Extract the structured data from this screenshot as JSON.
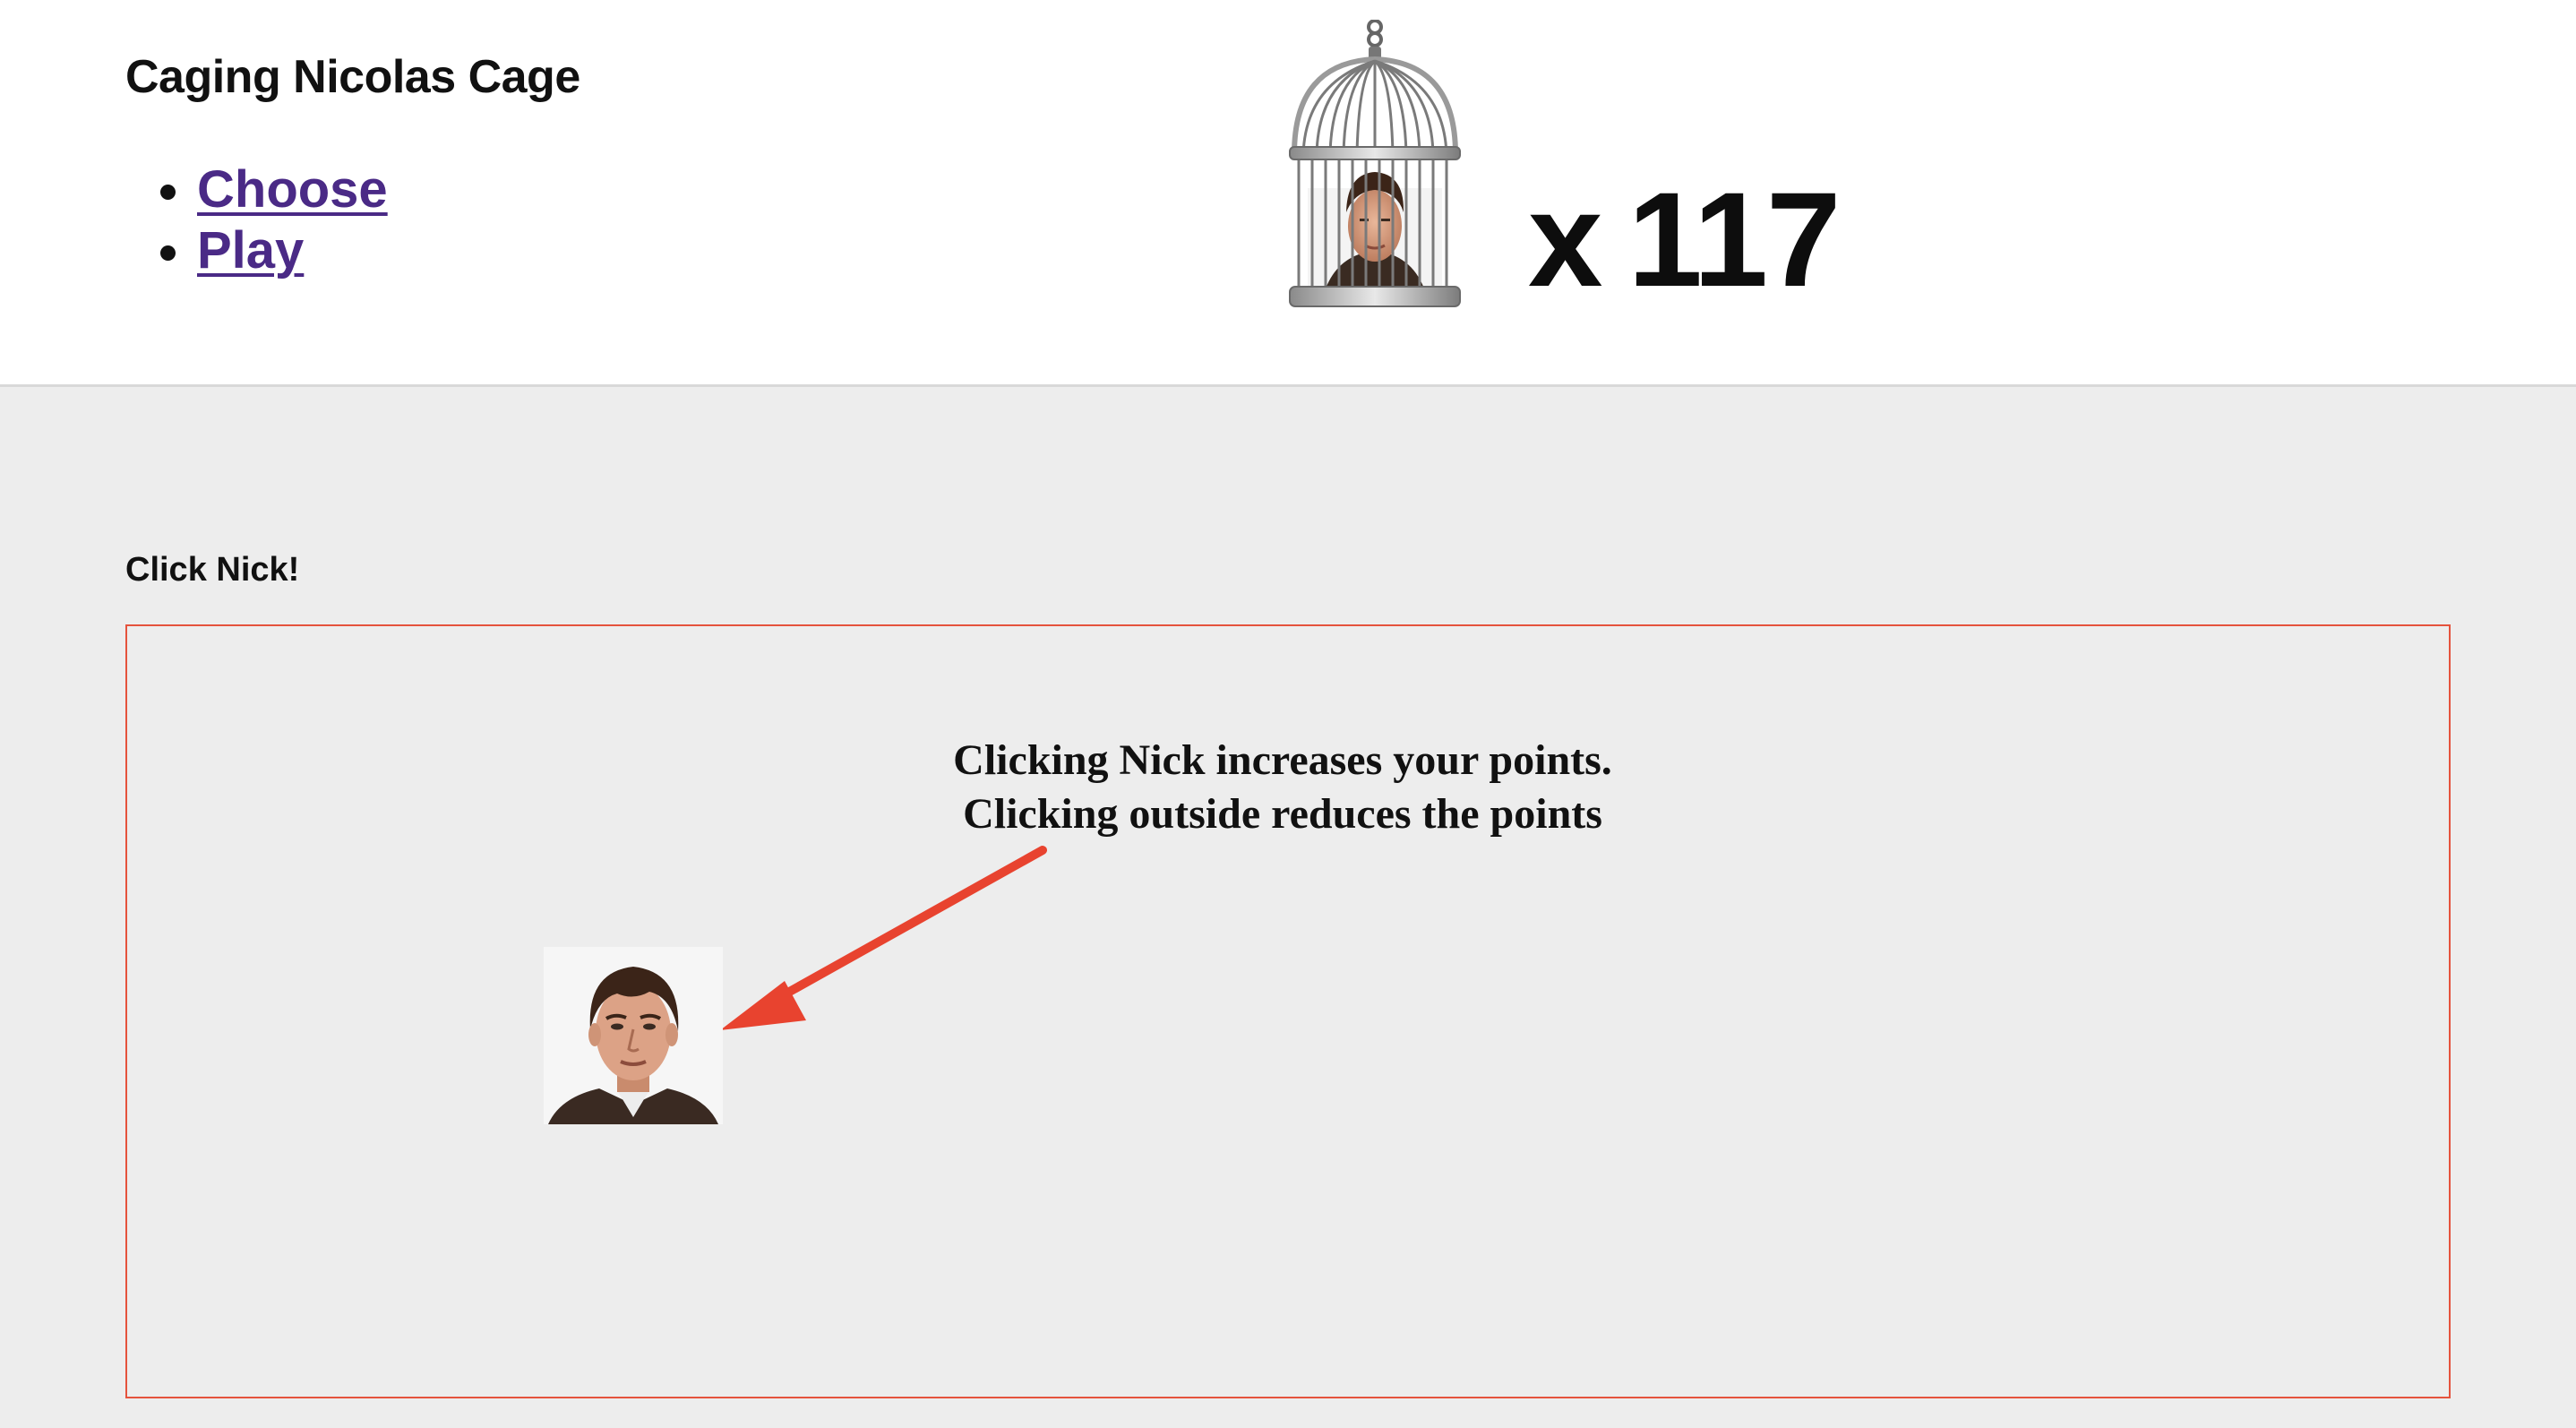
{
  "header": {
    "title": "Caging Nicolas Cage",
    "nav": [
      {
        "label": "Choose"
      },
      {
        "label": "Play"
      }
    ],
    "score": {
      "prefix": "x",
      "value": "117"
    }
  },
  "main": {
    "instruction": "Click Nick!",
    "hint_lines": [
      "Clicking Nick increases your points.",
      "Clicking outside reduces the points"
    ]
  },
  "colors": {
    "link": "#4a2a86",
    "play_border": "#e5533d",
    "arrow": "#e8432f",
    "main_bg": "#ededed"
  },
  "icons": {
    "cage": "birdcage-with-face-icon",
    "target": "nicolas-cage-face-icon",
    "arrow": "red-arrow-icon"
  }
}
